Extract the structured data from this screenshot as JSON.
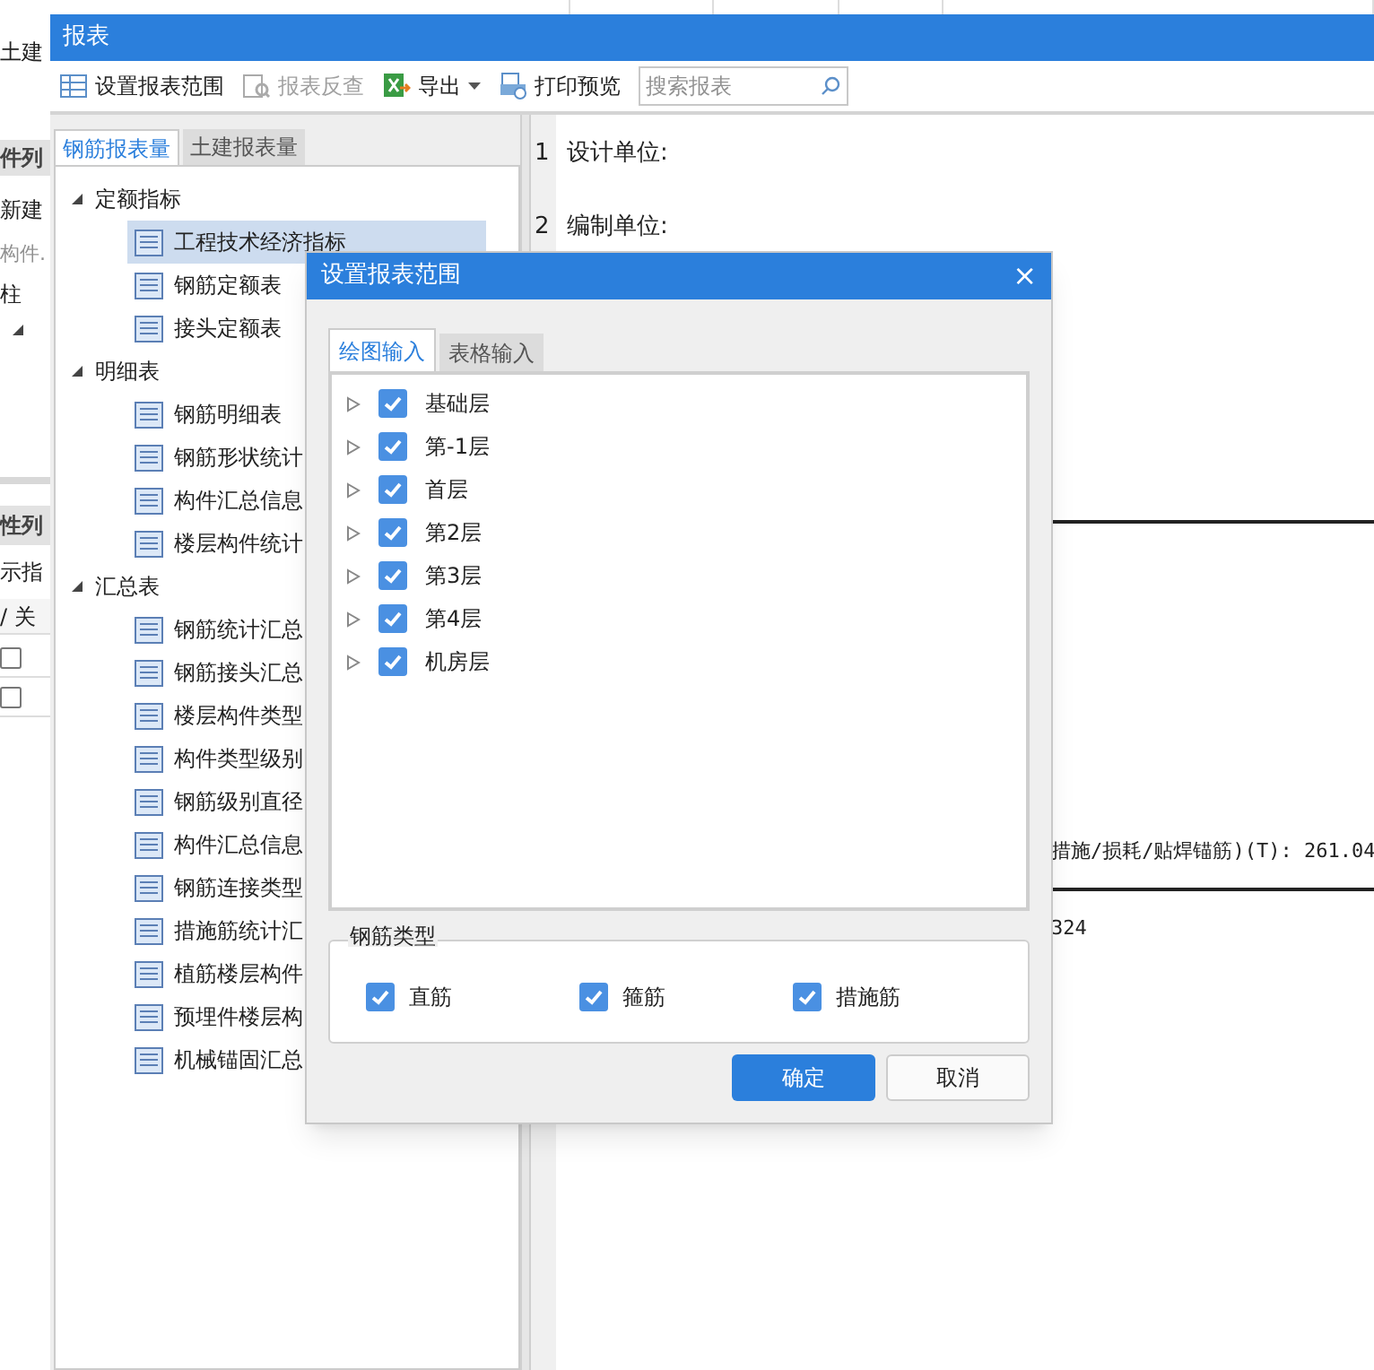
{
  "background_window": {
    "title": "土建",
    "panel_header": "件列",
    "new_button": "新建",
    "search": {
      "placeholder": "构件."
    },
    "tree_item": "柱",
    "properties_header": "性列",
    "note": "示指",
    "column_header": "/ 关",
    "rows": [
      {
        "checked": false
      },
      {
        "checked": false
      }
    ]
  },
  "window": {
    "title": "报表"
  },
  "toolbar": [
    {
      "kind": "range",
      "label": "设置报表范围",
      "disabled": false
    },
    {
      "kind": "lookup",
      "label": "报表反查",
      "disabled": true
    },
    {
      "kind": "export",
      "label": "导出",
      "dropdown": true,
      "disabled": false
    },
    {
      "kind": "print",
      "label": "打印预览",
      "disabled": false
    }
  ],
  "search": {
    "placeholder": "搜索报表"
  },
  "tabs": [
    {
      "label": "钢筋报表量",
      "selected": true
    },
    {
      "label": "土建报表量",
      "selected": false
    }
  ],
  "report_tree": [
    {
      "label": "定额指标",
      "expanded": true,
      "children": [
        {
          "label": "工程技术经济指标",
          "selected": true
        },
        {
          "label": "钢筋定额表",
          "selected": false
        },
        {
          "label": "接头定额表",
          "selected": false
        }
      ]
    },
    {
      "label": "明细表",
      "expanded": true,
      "children": [
        {
          "label": "钢筋明细表",
          "selected": false
        },
        {
          "label": "钢筋形状统计",
          "selected": false
        },
        {
          "label": "构件汇总信息",
          "selected": false
        },
        {
          "label": "楼层构件统计",
          "selected": false
        }
      ]
    },
    {
      "label": "汇总表",
      "expanded": true,
      "children": [
        {
          "label": "钢筋统计汇总",
          "selected": false
        },
        {
          "label": "钢筋接头汇总",
          "selected": false
        },
        {
          "label": "楼层构件类型",
          "selected": false
        },
        {
          "label": "构件类型级别",
          "selected": false
        },
        {
          "label": "钢筋级别直径",
          "selected": false
        },
        {
          "label": "构件汇总信息",
          "selected": false
        },
        {
          "label": "钢筋连接类型",
          "selected": false
        },
        {
          "label": "措施筋统计汇",
          "selected": false
        },
        {
          "label": "植筋楼层构件",
          "selected": false
        },
        {
          "label": "预埋件楼层构",
          "selected": false
        },
        {
          "label": "机械锚固汇总",
          "selected": false
        }
      ]
    }
  ],
  "report_preview": {
    "rows": [
      {
        "number": "1",
        "label": "设计单位:"
      },
      {
        "number": "2",
        "label": "编制单位:"
      }
    ],
    "total_line": "措施/损耗/贴焊锚筋)(T): 261.04",
    "count": "324"
  },
  "dialog": {
    "title": "设置报表范围",
    "close": "×",
    "tabs": [
      {
        "label": "绘图输入",
        "selected": true
      },
      {
        "label": "表格输入",
        "selected": false
      }
    ],
    "floors": [
      {
        "label": "基础层",
        "checked": true,
        "expanded": false
      },
      {
        "label": "第-1层",
        "checked": true,
        "expanded": false
      },
      {
        "label": "首层",
        "checked": true,
        "expanded": false
      },
      {
        "label": "第2层",
        "checked": true,
        "expanded": false
      },
      {
        "label": "第3层",
        "checked": true,
        "expanded": false
      },
      {
        "label": "第4层",
        "checked": true,
        "expanded": false
      },
      {
        "label": "机房层",
        "checked": true,
        "expanded": false
      }
    ],
    "rebar_types": {
      "title": "钢筋类型",
      "items": [
        {
          "label": "直筋",
          "checked": true
        },
        {
          "label": "箍筋",
          "checked": true
        },
        {
          "label": "措施筋",
          "checked": true
        }
      ]
    },
    "buttons": [
      {
        "kind": "primary",
        "label": "确定"
      },
      {
        "kind": "secondary",
        "label": "取消"
      }
    ]
  }
}
